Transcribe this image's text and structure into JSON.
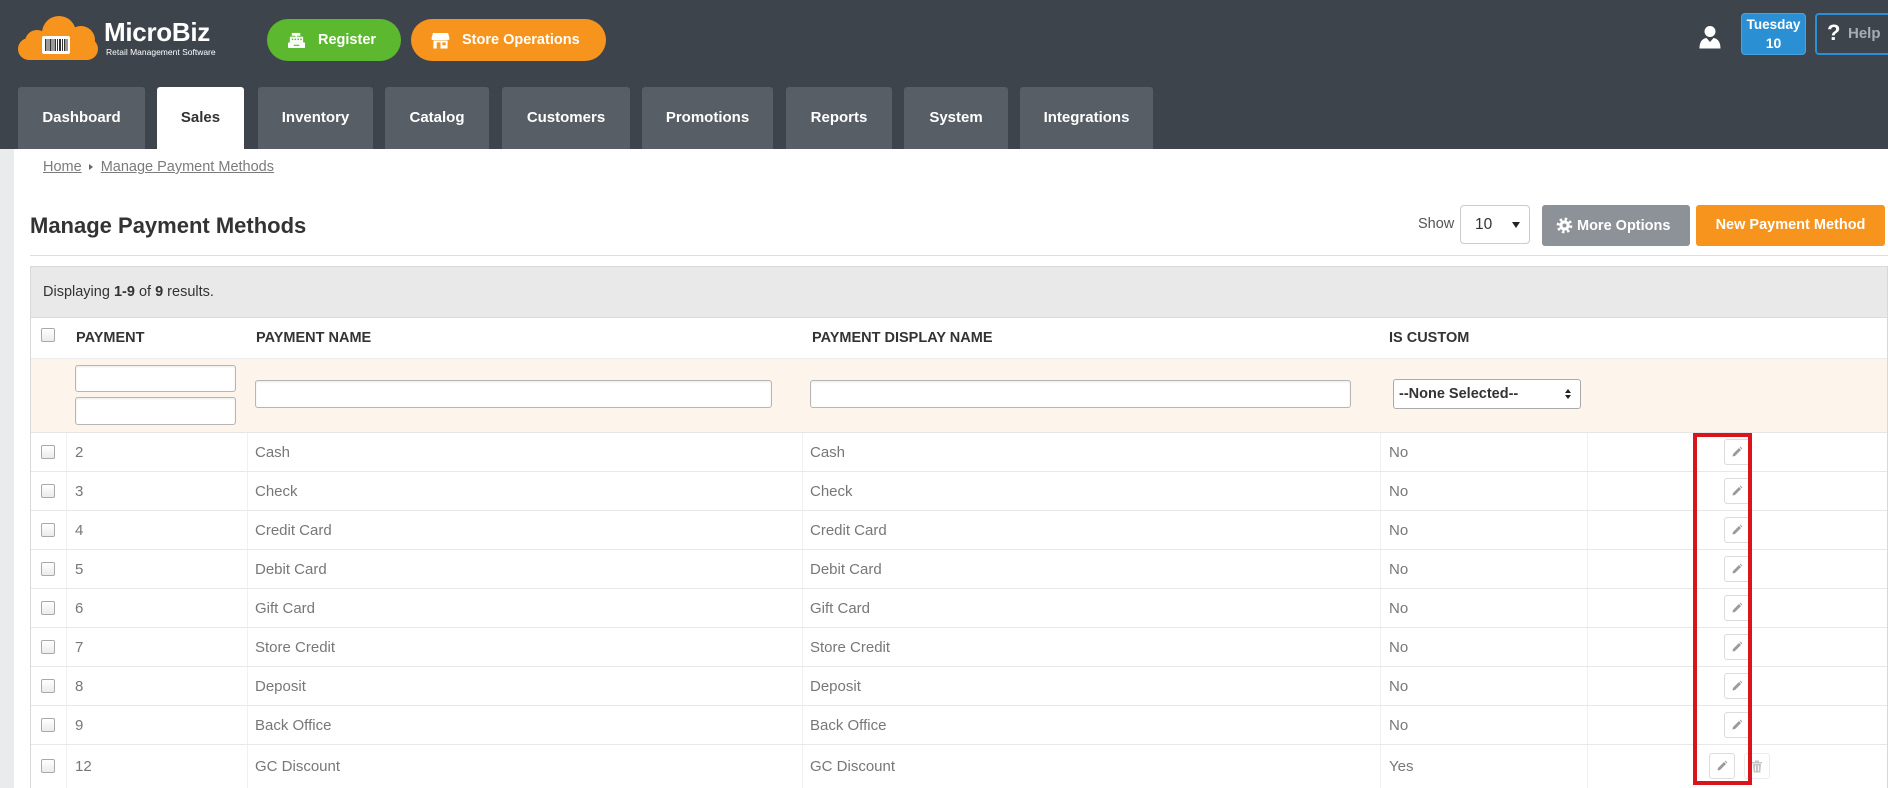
{
  "logo": {
    "name": "MicroBiz",
    "tagline": "Retail Management Software",
    "icon": "cloud-barcode-logo"
  },
  "topbar": {
    "register_label": "Register",
    "store_operations_label": "Store Operations",
    "date": {
      "weekday": "Tuesday",
      "day": "10"
    },
    "help_label": "Help"
  },
  "nav": {
    "tabs": [
      {
        "label": "Dashboard",
        "active": false
      },
      {
        "label": "Sales",
        "active": true
      },
      {
        "label": "Inventory",
        "active": false
      },
      {
        "label": "Catalog",
        "active": false
      },
      {
        "label": "Customers",
        "active": false
      },
      {
        "label": "Promotions",
        "active": false
      },
      {
        "label": "Reports",
        "active": false
      },
      {
        "label": "System",
        "active": false
      },
      {
        "label": "Integrations",
        "active": false
      }
    ]
  },
  "breadcrumb": {
    "home": "Home",
    "current": "Manage Payment Methods"
  },
  "page": {
    "title": "Manage Payment Methods"
  },
  "toolbar": {
    "show_label": "Show",
    "page_size": "10",
    "more_options_label": "More Options",
    "new_button_label": "New Payment Method"
  },
  "summary": {
    "prefix": "Displaying",
    "range": "1-9",
    "of": "of",
    "total": "9",
    "suffix": "results."
  },
  "table": {
    "columns": {
      "payment": "PAYMENT",
      "payment_name": "PAYMENT NAME",
      "payment_display_name": "PAYMENT DISPLAY NAME",
      "is_custom": "IS CUSTOM"
    },
    "filters": {
      "is_custom": "--None Selected--"
    },
    "rows": [
      {
        "payment": "2",
        "payment_name": "Cash",
        "payment_display_name": "Cash",
        "is_custom": "No",
        "actions": [
          "edit"
        ]
      },
      {
        "payment": "3",
        "payment_name": "Check",
        "payment_display_name": "Check",
        "is_custom": "No",
        "actions": [
          "edit"
        ]
      },
      {
        "payment": "4",
        "payment_name": "Credit Card",
        "payment_display_name": "Credit Card",
        "is_custom": "No",
        "actions": [
          "edit"
        ]
      },
      {
        "payment": "5",
        "payment_name": "Debit Card",
        "payment_display_name": "Debit Card",
        "is_custom": "No",
        "actions": [
          "edit"
        ]
      },
      {
        "payment": "6",
        "payment_name": "Gift Card",
        "payment_display_name": "Gift Card",
        "is_custom": "No",
        "actions": [
          "edit"
        ]
      },
      {
        "payment": "7",
        "payment_name": "Store Credit",
        "payment_display_name": "Store Credit",
        "is_custom": "No",
        "actions": [
          "edit"
        ]
      },
      {
        "payment": "8",
        "payment_name": "Deposit",
        "payment_display_name": "Deposit",
        "is_custom": "No",
        "actions": [
          "edit"
        ]
      },
      {
        "payment": "9",
        "payment_name": "Back Office",
        "payment_display_name": "Back Office",
        "is_custom": "No",
        "actions": [
          "edit"
        ]
      },
      {
        "payment": "12",
        "payment_name": "GC Discount",
        "payment_display_name": "GC Discount",
        "is_custom": "Yes",
        "actions": [
          "edit",
          "delete"
        ]
      }
    ]
  },
  "icons": {
    "register": "cash-register-icon",
    "store_operations": "store-icon",
    "user": "user-icon",
    "help": "question-icon",
    "more_options": "gear-icon",
    "edit": "pencil-icon",
    "delete": "trash-icon"
  },
  "colors": {
    "header_bg": "#3e444b",
    "tab_bg": "#575e66",
    "register_green": "#5cb82f",
    "accent_orange": "#f7941d",
    "date_blue": "#2b8fd4",
    "more_options_gray": "#8d9298",
    "filter_row_bg": "#fdf5ec",
    "highlight_red": "#d9141c"
  }
}
